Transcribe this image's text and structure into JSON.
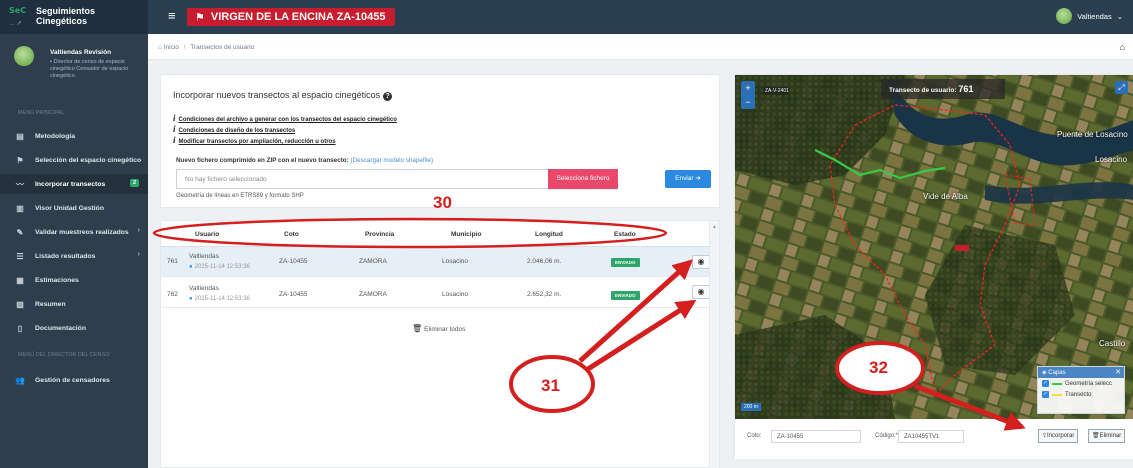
{
  "brand": {
    "logo": "SeC",
    "title": "Seguimientos Cinegéticos",
    "sub": "← ↗"
  },
  "header": {
    "title": "VIRGEN DE LA ENCINA ZA-10455",
    "user": "Valtiendas"
  },
  "sidebar": {
    "user_name": "Valtiendas Revisión",
    "user_role": "Director de censo de espacio cinegético Censador de espacio cinegético",
    "section_main": "MENÚ PRINCIPAL",
    "section_director": "MENÚ DEL DIRECTOR DEL CENSO",
    "items": [
      {
        "label": "Metodología",
        "icon": "document-icon"
      },
      {
        "label": "Selección del espacio cinegético",
        "icon": "flag-icon"
      },
      {
        "label": "Incorporar transectos",
        "icon": "chart-line-icon",
        "badge": "2"
      },
      {
        "label": "Visor Unidad Gestión",
        "icon": "map-icon"
      },
      {
        "label": "Validar muestreos realizados",
        "icon": "edit-icon"
      },
      {
        "label": "Listado resultados",
        "icon": "list-icon"
      },
      {
        "label": "Estimaciones",
        "icon": "calculator-icon"
      },
      {
        "label": "Resumen",
        "icon": "image-icon"
      },
      {
        "label": "Documentación",
        "icon": "file-icon"
      },
      {
        "label": "Gestión de censadores",
        "icon": "users-icon"
      }
    ]
  },
  "breadcrumb": {
    "home": "Inicio",
    "current": "Transectos de usuario"
  },
  "upload": {
    "title": "Incorporar nuevos transectos al espacio cinegéticos",
    "links": [
      "Condiciones del archivo a generar con los transectos del espacio cinegético",
      "Condiciones de diseño de los transectos",
      "Modificar transectos por ampliación, reducción u otros"
    ],
    "file_label": "Nuevo fichero comprimido en ZIP con el nuevo transecto:",
    "download_link": "(Descargar modelo shapefile)",
    "file_placeholder": "No hay fichero seleccionado",
    "select_button": "Selecciona fichero",
    "send_button": "Enviar",
    "hint": "Geometría de líneas en ETRS89 y formato SHP"
  },
  "table": {
    "columns": [
      "Usuario",
      "Coto",
      "Provincia",
      "Municipio",
      "Longitud",
      "Estado"
    ],
    "rows": [
      {
        "id": "761",
        "user": "Valtiendas",
        "date": "2025-11-14 12:53:36",
        "coto": "ZA-10455",
        "provincia": "ZAMORA",
        "municipio": "Losacino",
        "longitud": "2.046,06 m.",
        "estado": "ENVIADO"
      },
      {
        "id": "762",
        "user": "Valtiendas",
        "date": "2025-11-14 12:53:36",
        "coto": "ZA-10455",
        "provincia": "ZAMORA",
        "municipio": "Losacino",
        "longitud": "2.652,32 m.",
        "estado": "ENVIADO"
      }
    ],
    "delete_all": "Eliminar todos"
  },
  "map": {
    "info_label": "Transecto de usuario:",
    "info_value": "761",
    "places": [
      "Vide de Alba",
      "Puente de Losacino",
      "Losacino",
      "Castillo"
    ],
    "road_tag": "ZA-V-2401",
    "scale": "200 m",
    "layers_title": "Capas",
    "layers": [
      {
        "label": "Geometría selecc",
        "color": "#36c94a"
      },
      {
        "label": "Transecto",
        "color": "#f2e03a"
      }
    ],
    "coto_label": "Coto:",
    "coto_value": "ZA-10455",
    "codigo_label": "Código:*",
    "codigo_value": "ZA10455TV1",
    "incorporar_button": "Incorporar",
    "eliminar_button": "Eliminar"
  },
  "annotations": {
    "n30": "30",
    "n31": "31",
    "n32": "32",
    "color": "#d41f1f"
  }
}
